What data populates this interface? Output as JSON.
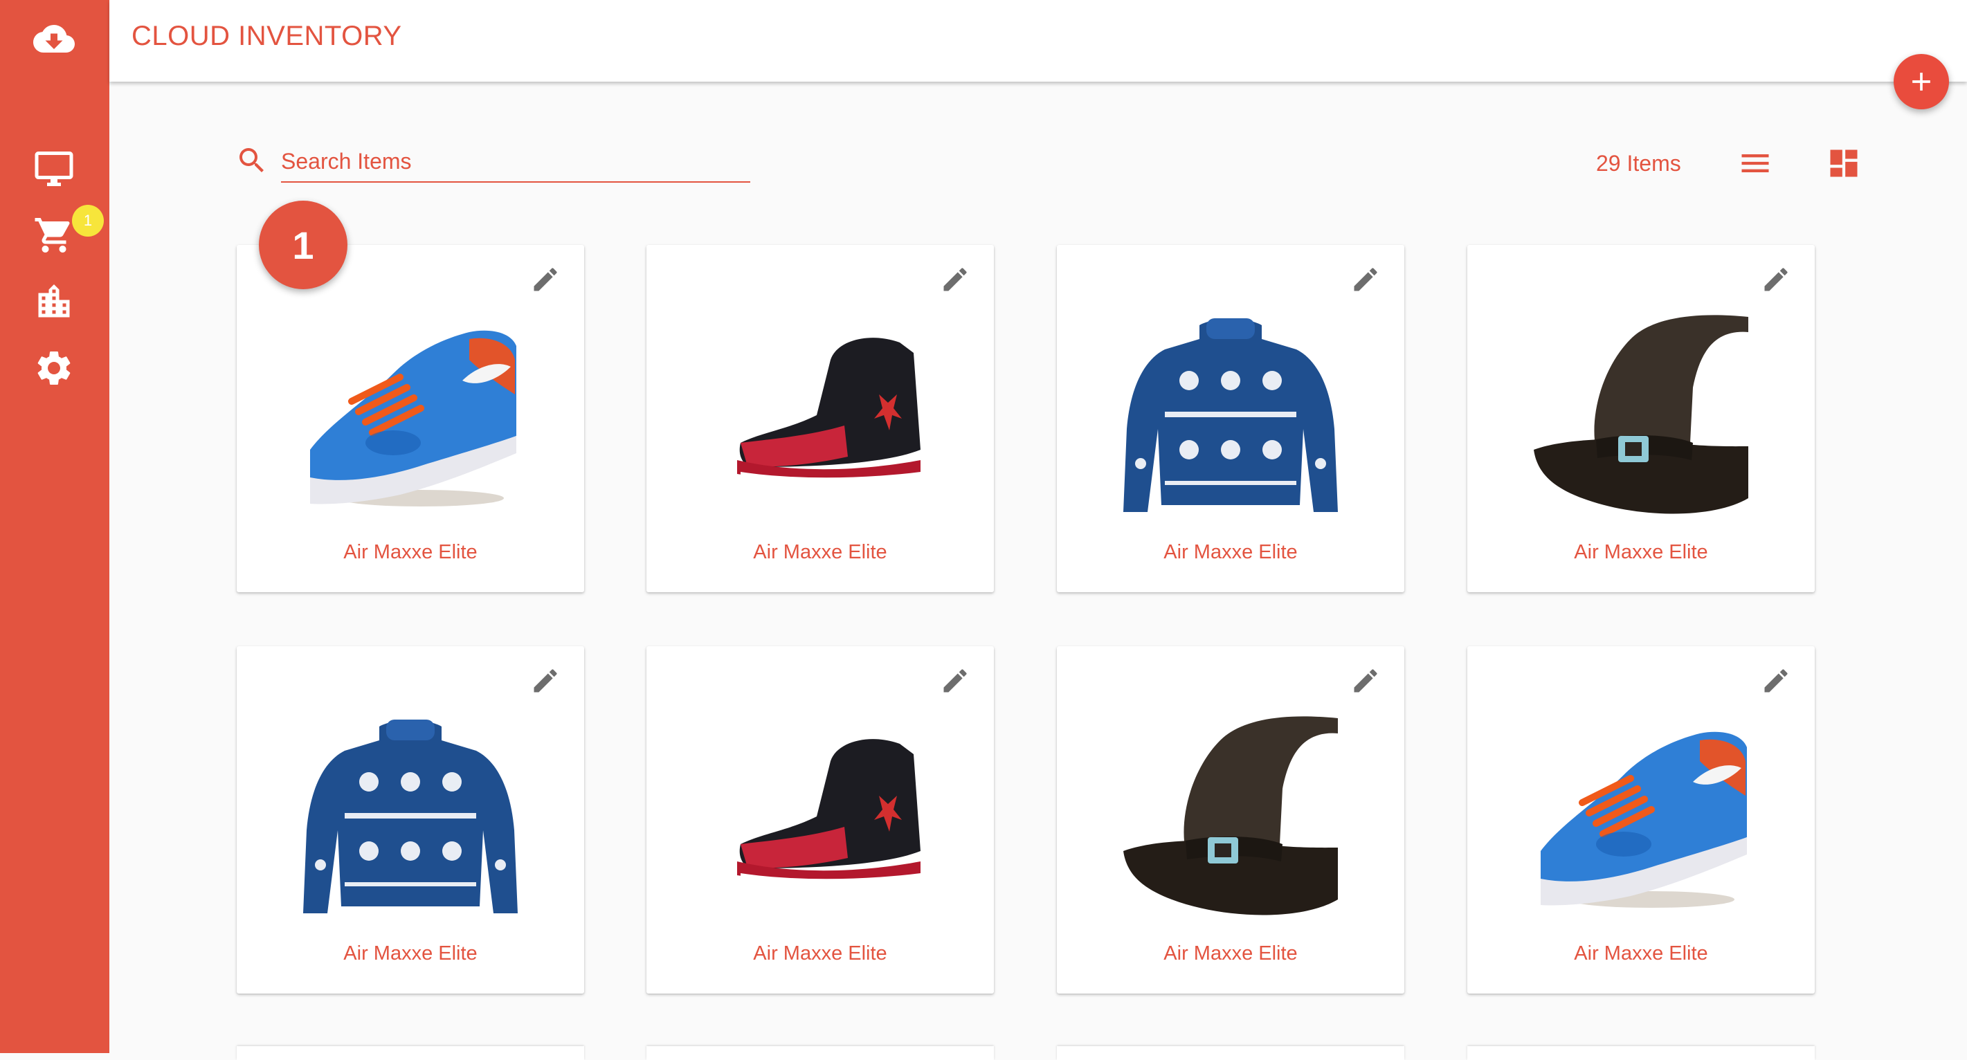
{
  "sidebar": {
    "logo_icon": "cloud-download-icon",
    "nav_icons": [
      "desktop-icon",
      "cart-icon",
      "warehouse-icon",
      "gear-icon"
    ],
    "cart_badge": "1",
    "background": "#e35440"
  },
  "header": {
    "title_part1": "CLOUD",
    "title_part2": "INVENTORY"
  },
  "search": {
    "placeholder": "Search Items"
  },
  "toolbar": {
    "item_count": "29 Items",
    "list_view_icon": "list-view-icon",
    "grid_view_icon": "grid-view-icon"
  },
  "step_marker": "1",
  "items": [
    {
      "name": "Air Maxxe Elite",
      "image": "blue-sneaker"
    },
    {
      "name": "Air Maxxe Elite",
      "image": "red-black-high-top"
    },
    {
      "name": "Air Maxxe Elite",
      "image": "blue-knit-sweater"
    },
    {
      "name": "Air Maxxe Elite",
      "image": "witch-hat"
    },
    {
      "name": "Air Maxxe Elite",
      "image": "blue-knit-sweater"
    },
    {
      "name": "Air Maxxe Elite",
      "image": "red-black-high-top"
    },
    {
      "name": "Air Maxxe Elite",
      "image": "witch-hat"
    },
    {
      "name": "Air Maxxe Elite",
      "image": "blue-sneaker"
    }
  ],
  "colors": {
    "accent": "#e35440",
    "badge_yellow": "#f7e53b",
    "edit_icon": "#6d6d6d"
  }
}
